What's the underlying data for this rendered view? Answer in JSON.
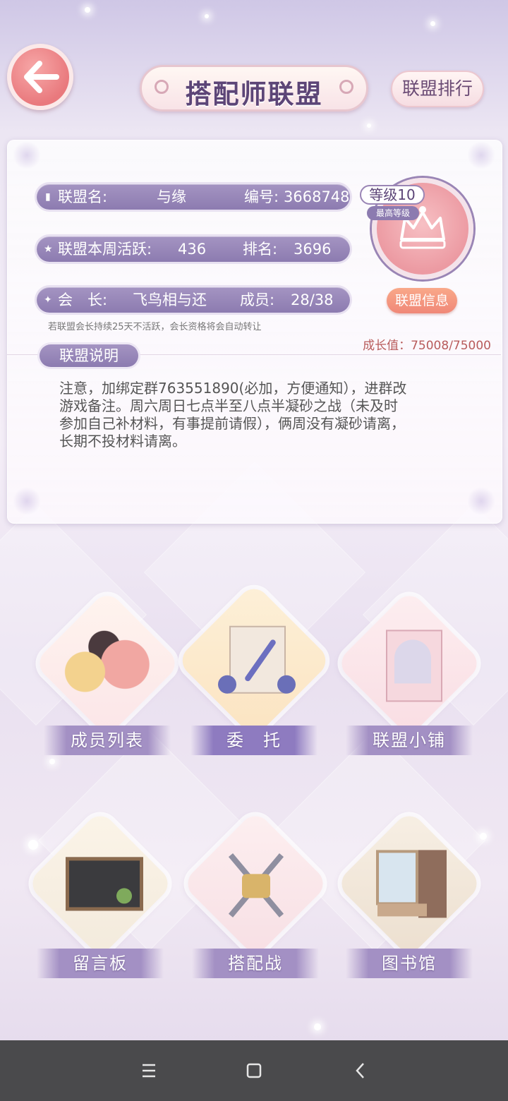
{
  "header": {
    "title": "搭配师联盟",
    "rank_button": "联盟排行"
  },
  "alliance": {
    "name_label": "联盟名:",
    "name_value": "与缘",
    "id_label": "编号:",
    "id_value": "3668748",
    "activity_label": "联盟本周活跃:",
    "activity_value": "436",
    "rank_label": "排名:",
    "rank_value": "3696",
    "leader_label": "会　长:",
    "leader_value": "飞鸟相与还",
    "members_label": "成员:",
    "members_value": "28/38",
    "level_text": "等级10",
    "level_sub": "最高等级",
    "info_button": "联盟信息",
    "warning": "若联盟会长持续25天不活跃，会长资格将会自动转让",
    "growth": "成长值：75008/75000",
    "growth_fraction": 1.0
  },
  "description": {
    "title": "联盟说明",
    "text": "注意，加绑定群763551890(必加，方便通知），进群改\n游戏备注。周六周日七点半至八点半凝砂之战（未及时\n参加自己补材料，有事提前请假），俩周没有凝砂请离，\n长期不投材料请离。"
  },
  "tiles": [
    {
      "label": "成员列表",
      "icon": "members-illustration"
    },
    {
      "label": "委　托",
      "icon": "envelope-quill-illustration"
    },
    {
      "label": "联盟小铺",
      "icon": "shop-illustration"
    },
    {
      "label": "留言板",
      "icon": "chalkboard-illustration"
    },
    {
      "label": "搭配战",
      "icon": "crossed-swords-crest-illustration"
    },
    {
      "label": "图书馆",
      "icon": "library-illustration"
    }
  ],
  "nav": {
    "menu_icon": "menu-icon",
    "home_icon": "home-square-icon",
    "back_icon": "back-chevron-icon"
  },
  "colors": {
    "accent_purple": "#8c7bb0",
    "back_button": "#e9797d",
    "info_button": "#f08878",
    "growth_text": "#b85b5b"
  }
}
